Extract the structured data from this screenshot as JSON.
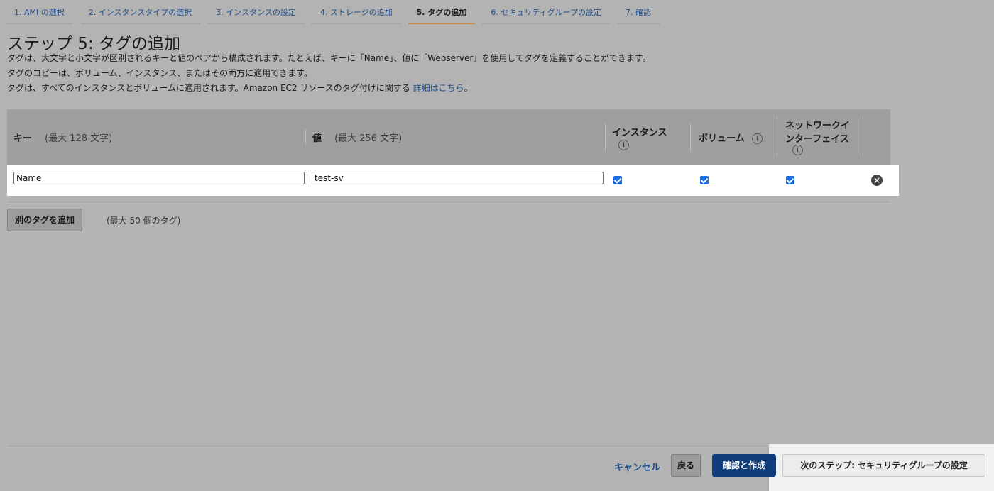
{
  "steps": [
    "1. AMI の選択",
    "2. インスタンスタイプの選択",
    "3. インスタンスの設定",
    "4. ストレージの追加",
    "5. タグの追加",
    "6. セキュリティグループの設定",
    "7. 確認"
  ],
  "page": {
    "title": "ステップ 5: タグの追加",
    "desc1": "タグは、大文字と小文字が区別されるキーと値のペアから構成されます。たとえば、キーに「Name」、値に「Webserver」を使用してタグを定義することができます。",
    "desc2": "タグのコピーは、ボリューム、インスタンス、またはその両方に適用できます。",
    "desc3": "タグは、すべてのインスタンスとボリュームに適用されます。Amazon EC2 リソースのタグ付けに関する",
    "desc3_link": "詳細はこちら",
    "desc3_end": "。"
  },
  "table": {
    "key_header": "キー",
    "key_hint": "(最大 128 文字)",
    "value_header": "値",
    "value_hint": "(最大 256 文字)",
    "instance_header": "インスタンス",
    "volume_header": "ボリューム",
    "network_header_1": "ネットワークイ",
    "network_header_2": "ンターフェイス",
    "info_glyph": "i",
    "rows": [
      {
        "key": "Name",
        "value": "test-sv",
        "instance": true,
        "volume": true,
        "network": true
      }
    ]
  },
  "add_tag_button": "別のタグを追加",
  "add_tag_note": "(最大 50 個のタグ)",
  "footer": {
    "cancel": "キャンセル",
    "back": "戻る",
    "review": "確認と作成",
    "next": "次のステップ: セキュリティグループの設定"
  },
  "colors": {
    "primary": "#0f3d7a",
    "link": "#1f4e8c",
    "active_tab": "#d9822b",
    "checkbox": "#1a6be0"
  }
}
